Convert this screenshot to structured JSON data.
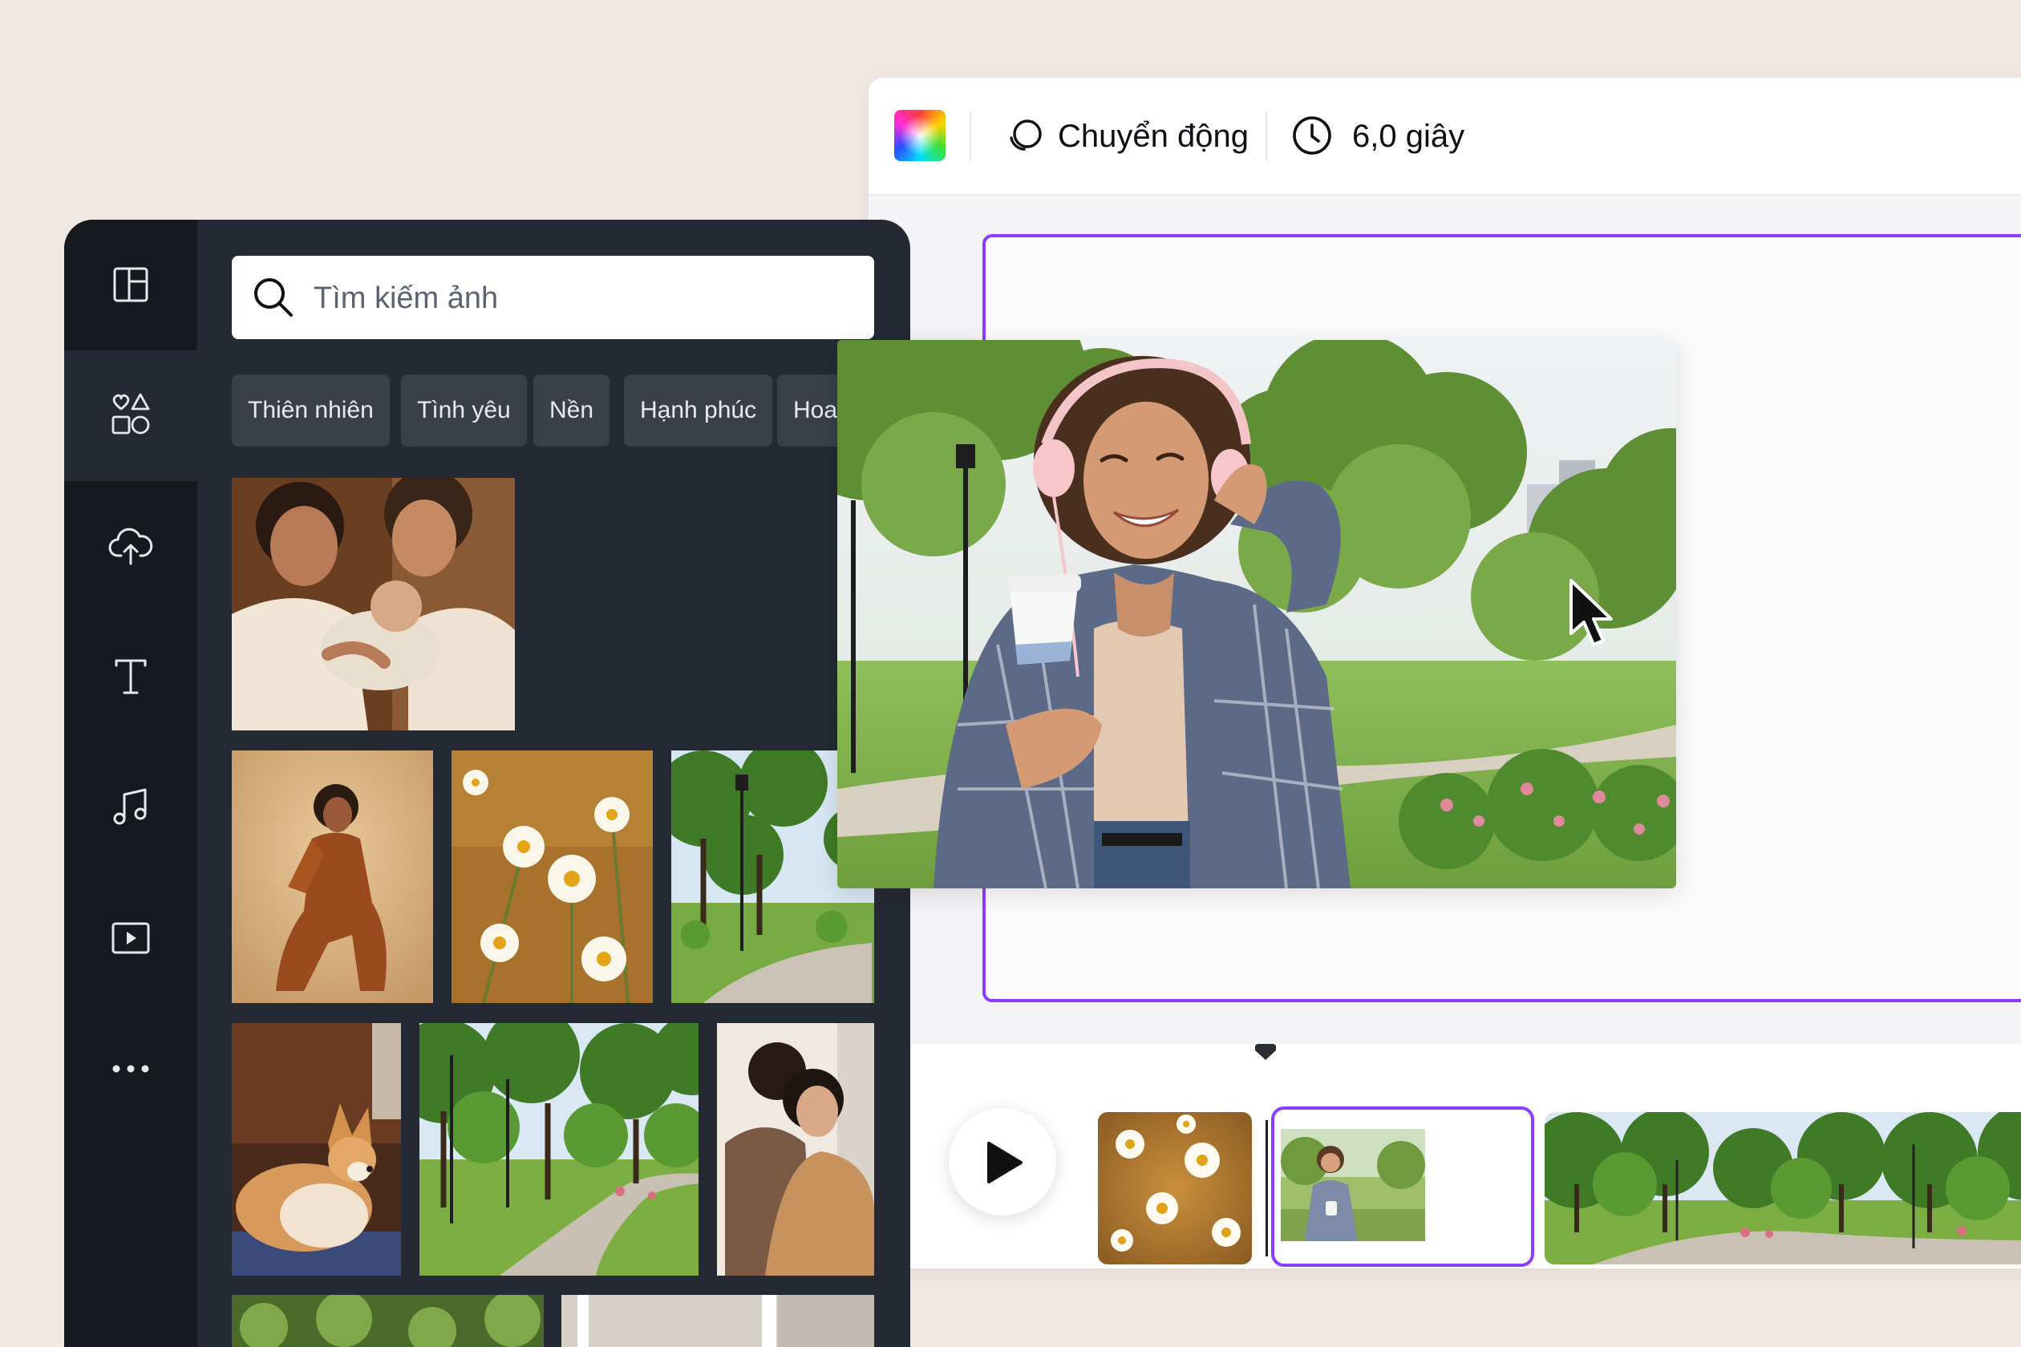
{
  "toolbar": {
    "animate_label": "Chuyển động",
    "animate_icon": "animate-icon",
    "duration_label": "6,0 giây",
    "duration_icon": "clock-icon",
    "color_icon": "color-picker-icon"
  },
  "sidebar": {
    "items": [
      {
        "icon": "layout-icon",
        "active": false
      },
      {
        "icon": "elements-icon",
        "active": true
      },
      {
        "icon": "upload-cloud-icon",
        "active": false
      },
      {
        "icon": "text-icon",
        "active": false
      },
      {
        "icon": "music-icon",
        "active": false
      },
      {
        "icon": "video-icon",
        "active": false
      },
      {
        "icon": "more-icon",
        "active": false
      }
    ]
  },
  "search": {
    "placeholder": "Tìm kiếm ảnh",
    "icon": "search-icon"
  },
  "chips": [
    "Thiên nhiên",
    "Tình yêu",
    "Nền",
    "Hạnh phúc",
    "Hoa"
  ],
  "photos": [
    {
      "subject": "family-with-newborn"
    },
    {
      "subject": "woman-in-rust-outfit"
    },
    {
      "subject": "daisies"
    },
    {
      "subject": "park-lamp-path"
    },
    {
      "subject": "corgi-dog"
    },
    {
      "subject": "park-trees-path"
    },
    {
      "subject": "couple-hug"
    }
  ],
  "canvas": {
    "photo": "woman-with-headphones-and-coffee",
    "accent_color": "#8b3dff"
  },
  "timeline": {
    "clips": [
      "daisies",
      "woman-with-headphones",
      "park-panorama"
    ],
    "selected_clip_index": 1
  },
  "colors": {
    "panel_bg": "#252933",
    "rail_bg": "#17191f",
    "accent": "#8b3dff",
    "page_bg": "#f1e8e4"
  }
}
